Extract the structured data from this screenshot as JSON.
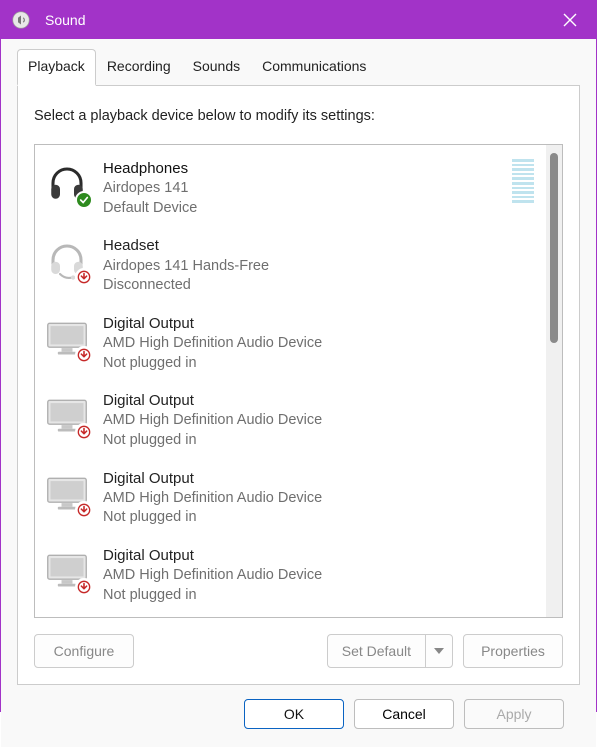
{
  "window": {
    "title": "Sound"
  },
  "tabs": [
    {
      "label": "Playback",
      "active": true
    },
    {
      "label": "Recording",
      "active": false
    },
    {
      "label": "Sounds",
      "active": false
    },
    {
      "label": "Communications",
      "active": false
    }
  ],
  "instruction": "Select a playback device below to modify its settings:",
  "devices": [
    {
      "name": "Headphones",
      "sub": "Airdopes 141",
      "status": "Default Device",
      "icon": "headphones",
      "overlay": "check",
      "vu": true,
      "faded": false
    },
    {
      "name": "Headset",
      "sub": "Airdopes 141 Hands-Free",
      "status": "Disconnected",
      "icon": "headset",
      "overlay": "down",
      "vu": false,
      "faded": true
    },
    {
      "name": "Digital Output",
      "sub": "AMD High Definition Audio Device",
      "status": "Not plugged in",
      "icon": "monitor",
      "overlay": "down",
      "vu": false,
      "faded": true
    },
    {
      "name": "Digital Output",
      "sub": "AMD High Definition Audio Device",
      "status": "Not plugged in",
      "icon": "monitor",
      "overlay": "down",
      "vu": false,
      "faded": true
    },
    {
      "name": "Digital Output",
      "sub": "AMD High Definition Audio Device",
      "status": "Not plugged in",
      "icon": "monitor",
      "overlay": "down",
      "vu": false,
      "faded": true
    },
    {
      "name": "Digital Output",
      "sub": "AMD High Definition Audio Device",
      "status": "Not plugged in",
      "icon": "monitor",
      "overlay": "down",
      "vu": false,
      "faded": true
    }
  ],
  "buttons": {
    "configure": "Configure",
    "set_default": "Set Default",
    "properties": "Properties",
    "ok": "OK",
    "cancel": "Cancel",
    "apply": "Apply"
  }
}
